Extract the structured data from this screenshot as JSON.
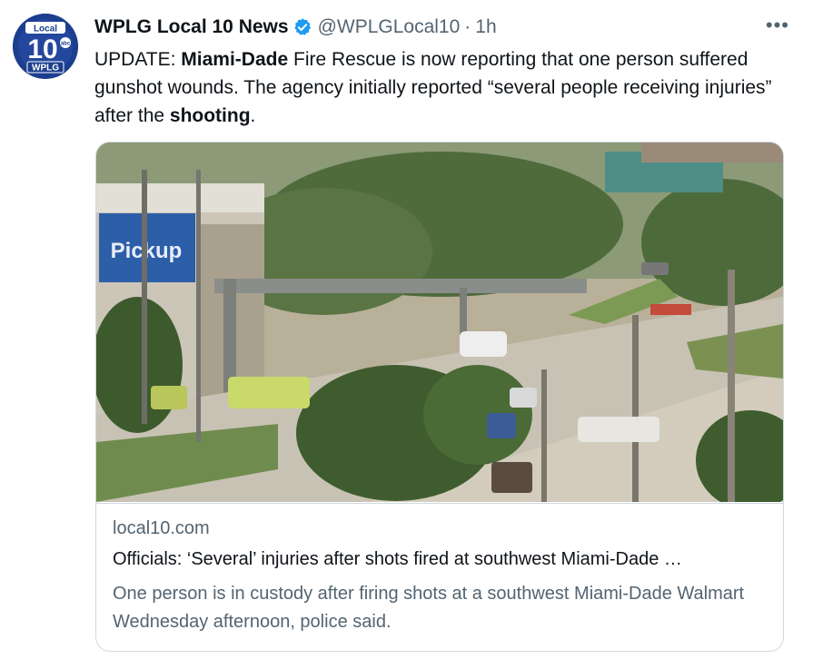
{
  "tweet": {
    "author": {
      "display_name": "WPLG Local 10 News",
      "handle": "@WPLGLocal10",
      "verified": true,
      "avatar_text_top": "Local",
      "avatar_number": "10",
      "avatar_text_bottom": "WPLG",
      "avatar_network": "abc"
    },
    "separator": "·",
    "timestamp": "1h",
    "more_icon": "more-horizontal-icon",
    "text_segments": [
      {
        "text": "UPDATE: ",
        "bold": false
      },
      {
        "text": "Miami-Dade",
        "bold": true
      },
      {
        "text": " Fire Rescue is now reporting that one person suffered gunshot wounds. The agency initially reported “several people receiving injuries” after the ",
        "bold": false
      },
      {
        "text": "shooting",
        "bold": true
      },
      {
        "text": ".",
        "bold": false
      }
    ]
  },
  "card": {
    "image_sign_text": "Pickup",
    "domain": "local10.com",
    "title": "Officials: ‘Several’ injuries after shots fired at southwest Miami-Dade …",
    "description": "One person is in custody after firing shots at a southwest Miami-Dade Walmart Wednesday afternoon, police said."
  },
  "colors": {
    "text": "#0f1419",
    "secondary": "#536471",
    "verified_blue": "#1d9bf0",
    "border": "#cfd9de",
    "avatar_blue": "#1c3e8e"
  }
}
